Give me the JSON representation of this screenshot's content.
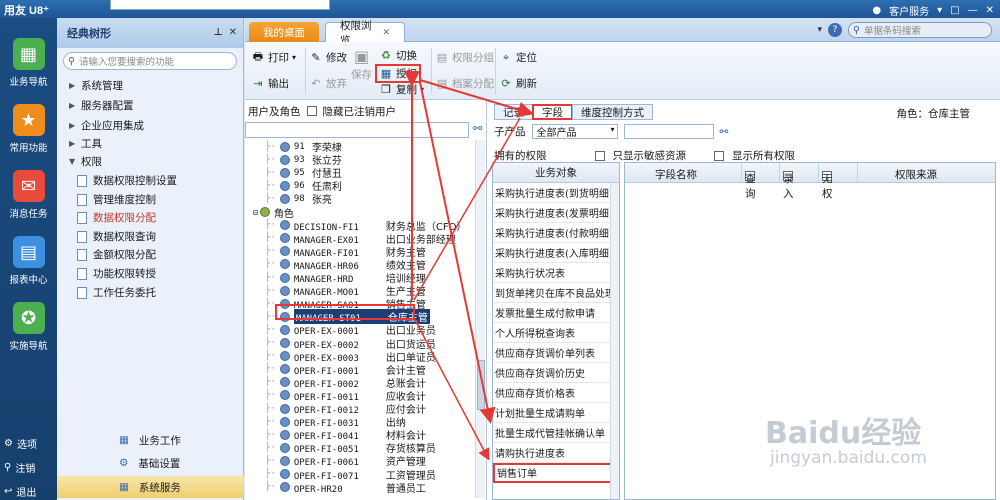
{
  "app": {
    "brand": "用友 U8⁺",
    "service": "客户服务",
    "window_controls": [
      "□",
      "—",
      "✕"
    ]
  },
  "leftnav": [
    {
      "label": "业务导航",
      "icon": "grid-icon",
      "color": "#4caf50",
      "glyph": "▦"
    },
    {
      "label": "常用功能",
      "icon": "star-icon",
      "color": "#f08c1c",
      "glyph": "★"
    },
    {
      "label": "消息任务",
      "icon": "mail-icon",
      "color": "#e84a3c",
      "glyph": "✉"
    },
    {
      "label": "报表中心",
      "icon": "report-icon",
      "color": "#3d8fe0",
      "glyph": "▤"
    },
    {
      "label": "实施导航",
      "icon": "compass-icon",
      "color": "#4caf50",
      "glyph": "✪"
    }
  ],
  "leftnav_bottom": [
    {
      "label": "选项",
      "glyph": "⚙"
    },
    {
      "label": "注销",
      "glyph": "⚲"
    },
    {
      "label": "退出",
      "glyph": "↩"
    }
  ],
  "treepanel": {
    "title": "经典树形",
    "search_placeholder": "请输入您要搜索的功能",
    "groups": [
      "系统管理",
      "服务器配置",
      "企业应用集成",
      "工具",
      "权限"
    ],
    "perm_items": [
      "数据权限控制设置",
      "管理维度控制",
      "数据权限分配",
      "数据权限查询",
      "金额权限分配",
      "功能权限转授",
      "工作任务委托"
    ],
    "selected_perm_item": "数据权限分配",
    "bottom": [
      "业务工作",
      "基础设置",
      "系统服务"
    ],
    "active_bottom": "系统服务"
  },
  "tabs": {
    "desktop": "我的桌面",
    "current": "权限浏览"
  },
  "tabbar": {
    "help": "?",
    "search_placeholder": "单据条码搜索"
  },
  "toolbar": {
    "print": "打印",
    "export": "输出",
    "edit": "修改",
    "abandon": "放弃",
    "save": "保存",
    "switch": "切换",
    "authorize": "授权",
    "copy": "复制",
    "perm_group": "权限分组",
    "archive": "档案分配",
    "locate": "定位",
    "refresh": "刷新"
  },
  "user_role": {
    "label": "用户及角色",
    "hide_cancelled": "隐藏已注销用户",
    "users": [
      {
        "code": "91",
        "name": "李荣棣"
      },
      {
        "code": "93",
        "name": "张立芬"
      },
      {
        "code": "95",
        "name": "付慧丑"
      },
      {
        "code": "96",
        "name": "任肃利"
      },
      {
        "code": "98",
        "name": "张亮"
      }
    ],
    "role_root": "角色",
    "roles": [
      {
        "code": "DECISION-FI1",
        "name": "财务总监（CFO）"
      },
      {
        "code": "MANAGER-EX01",
        "name": "出口业务部经理"
      },
      {
        "code": "MANAGER-FI01",
        "name": "财务主管"
      },
      {
        "code": "MANAGER-HR06",
        "name": "绩效主管"
      },
      {
        "code": "MANAGER-HRD",
        "name": "培训经理"
      },
      {
        "code": "MANAGER-MO01",
        "name": "生产主管"
      },
      {
        "code": "MANAGER-SA01",
        "name": "销售主管"
      },
      {
        "code": "MANAGER-ST01",
        "name": "仓库主管"
      },
      {
        "code": "OPER-EX-0001",
        "name": "出口业务员"
      },
      {
        "code": "OPER-EX-0002",
        "name": "出口货运员"
      },
      {
        "code": "OPER-EX-0003",
        "name": "出口单证员"
      },
      {
        "code": "OPER-FI-0001",
        "name": "会计主管"
      },
      {
        "code": "OPER-FI-0002",
        "name": "总账会计"
      },
      {
        "code": "OPER-FI-0011",
        "name": "应收会计"
      },
      {
        "code": "OPER-FI-0012",
        "name": "应付会计"
      },
      {
        "code": "OPER-FI-0031",
        "name": "出纳"
      },
      {
        "code": "OPER-FI-0041",
        "name": "材料会计"
      },
      {
        "code": "OPER-FI-0051",
        "name": "存货核算员"
      },
      {
        "code": "OPER-FI-0061",
        "name": "资产管理"
      },
      {
        "code": "OPER-FI-0071",
        "name": "工资管理员"
      },
      {
        "code": "OPER-HR20",
        "name": "普通员工"
      }
    ],
    "selected_role": "MANAGER-ST01"
  },
  "right": {
    "subtabs": [
      "记录",
      "字段",
      "维度控制方式"
    ],
    "active_subtab": "字段",
    "role_label": "角色：仓库主管",
    "subproduct_label": "子产品",
    "subproduct_value": "全部产品",
    "owned_label": "拥有的权限",
    "only_sensitive": "只显示敏感资源",
    "show_all": "显示所有权限",
    "bo_header": "业务对象",
    "business_objects": [
      "采购执行进度表(到货明细)",
      "采购执行进度表(发票明细)",
      "采购执行进度表(付款明细)",
      "采购执行进度表(入库明细)",
      "采购执行状况表",
      "到货单拷贝在库不良品处理单",
      "发票批量生成付款申请",
      "个人所得税查询表",
      "供应商存货调价单列表",
      "供应商存货调价历史",
      "供应商存货价格表",
      "计划批量生成请购单",
      "批量生成代管挂帐确认单",
      "请购执行进度表",
      "销售订单"
    ],
    "highlighted_bo": "销售订单",
    "grid_cols": {
      "field": "字段名称",
      "query": "查询",
      "entry": "录入",
      "none": "无权",
      "source": "权限来源"
    }
  },
  "watermark": {
    "logo": "Baidu经验",
    "url": "jingyan.baidu.com"
  }
}
